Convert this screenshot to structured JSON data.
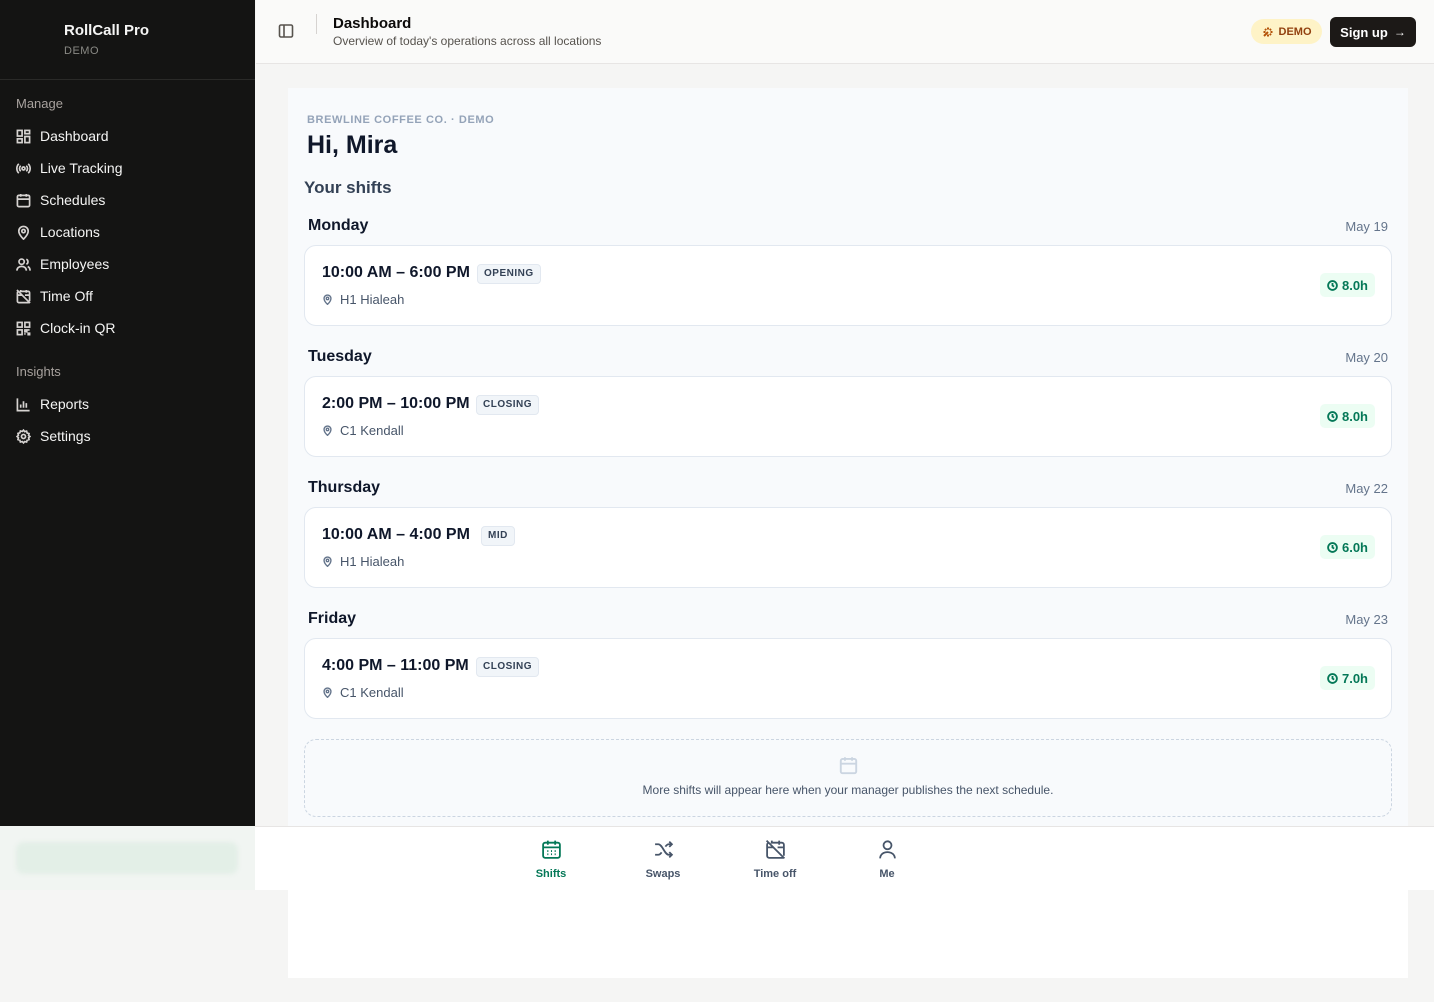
{
  "app": {
    "name": "RollCall Pro",
    "badge": "DEMO"
  },
  "sidebar": {
    "sections": [
      {
        "heading": "Manage",
        "items": [
          {
            "label": "Dashboard",
            "icon": "grid-icon"
          },
          {
            "label": "Live Tracking",
            "icon": "radio-icon"
          },
          {
            "label": "Schedules",
            "icon": "calendar-icon"
          },
          {
            "label": "Locations",
            "icon": "map-pin-icon"
          },
          {
            "label": "Employees",
            "icon": "users-icon"
          },
          {
            "label": "Time Off",
            "icon": "calendar-off-icon"
          },
          {
            "label": "Clock-in QR",
            "icon": "qr-code-icon"
          }
        ]
      },
      {
        "heading": "Insights",
        "items": [
          {
            "label": "Reports",
            "icon": "bar-chart-icon"
          },
          {
            "label": "Settings",
            "icon": "gear-icon"
          }
        ]
      }
    ]
  },
  "header": {
    "title": "Dashboard",
    "subtitle": "Overview of today's operations across all locations",
    "demo_label": "DEMO",
    "signup_label": "Sign up",
    "signup_arrow": "→"
  },
  "main": {
    "org_line": "BREWLINE COFFEE CO. · DEMO",
    "greeting": "Hi, Mira",
    "section_title": "Your shifts",
    "days": [
      {
        "day": "Monday",
        "date": "May 19",
        "time": "10:00 AM – 6:00 PM",
        "tag": "OPENING",
        "location": "H1 Hialeah",
        "hours": "8.0h"
      },
      {
        "day": "Tuesday",
        "date": "May 20",
        "time": "2:00 PM – 10:00 PM",
        "tag": "CLOSING",
        "location": "C1 Kendall",
        "hours": "8.0h"
      },
      {
        "day": "Thursday",
        "date": "May 22",
        "time": "10:00 AM – 4:00 PM",
        "tag": "MID",
        "location": "H1 Hialeah",
        "hours": "6.0h"
      },
      {
        "day": "Friday",
        "date": "May 23",
        "time": "4:00 PM – 11:00 PM",
        "tag": "CLOSING",
        "location": "C1 Kendall",
        "hours": "7.0h"
      }
    ],
    "more_note": "More shifts will appear here when your manager publishes the next schedule."
  },
  "tabbar": {
    "tabs": [
      {
        "label": "Shifts",
        "icon": "calendar-icon",
        "active": true
      },
      {
        "label": "Swaps",
        "icon": "shuffle-icon",
        "active": false
      },
      {
        "label": "Time off",
        "icon": "calendar-off-icon",
        "active": false
      },
      {
        "label": "Me",
        "icon": "user-icon",
        "active": false
      }
    ]
  },
  "colors": {
    "accent": "#047857",
    "sidebar_bg": "#141413",
    "demo_bg": "#fef3c7"
  }
}
